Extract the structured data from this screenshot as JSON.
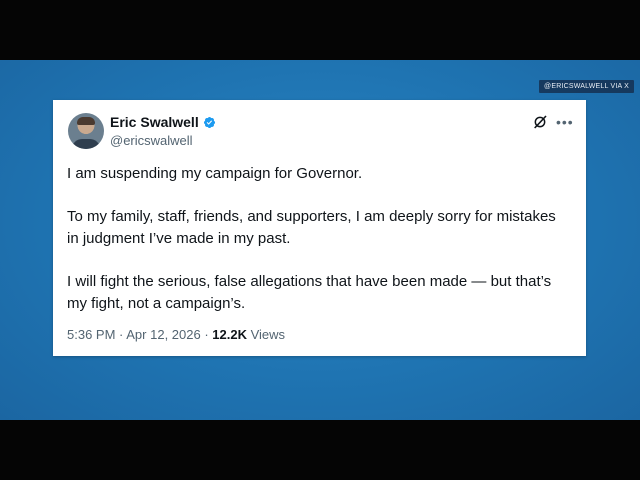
{
  "credit": "@ERICSWALWELL VIA X",
  "author": {
    "name": "Eric Swalwell",
    "handle": "@ericswalwell"
  },
  "tweet": {
    "paragraphs": [
      "I am suspending my campaign for Governor.",
      "To my family, staff, friends, and supporters, I am deeply sorry for mistakes in judgment I’ve made in my past.",
      "I will fight the serious, false allegations that have been made — but that’s my fight, not a campaign’s."
    ]
  },
  "meta": {
    "time": "5:36 PM",
    "sep1": " · ",
    "date": "Apr 12, 2026",
    "sep2": " · ",
    "views_count": "12.2K",
    "views_label": " Views"
  },
  "icons": {
    "verified": "verified-badge-icon",
    "grok": "grok-icon",
    "more": "more-icon"
  },
  "colors": {
    "backdrop": "#1f74b2",
    "verified": "#1d9bf0",
    "text": "#0f1419",
    "secondary": "#536471"
  }
}
